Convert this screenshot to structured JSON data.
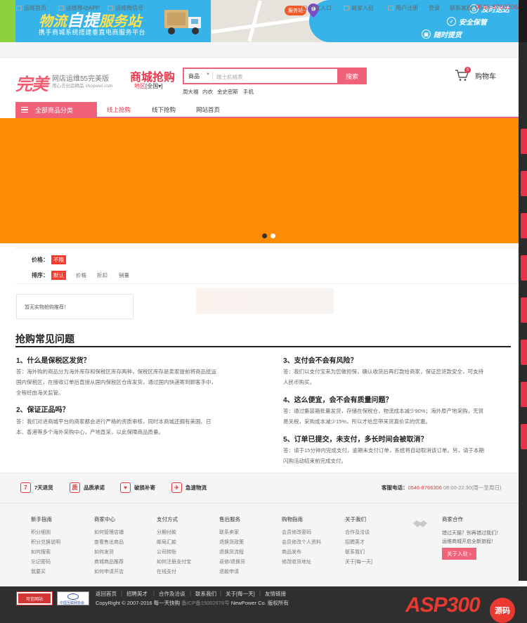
{
  "banner": {
    "title_a": "物流",
    "title_b": "自提",
    "title_c": "服务站",
    "subtitle": "携手商城系统搭建垂直电商服务平台",
    "map_tag": "服务站",
    "services": [
      "及时送达",
      "安全保管",
      "随时提货"
    ]
  },
  "topnav": {
    "left": [
      "运维首页",
      "运维移动APP",
      "运维微信号"
    ],
    "right": [
      "商家入口",
      "商家入驻",
      "用户注册",
      "登录",
      "联系客服"
    ],
    "phone": "0546-8766306"
  },
  "header": {
    "logo": "完美",
    "logo_line1": "网店运维55完美版",
    "logo_line2": "用心去创造精品 shopwwi.com",
    "shop_title": "商城抢购",
    "region_label": "地区",
    "region_value": "[全国",
    "search_category": "商品",
    "search_placeholder": "瑞士机械表",
    "search_button": "搜索",
    "hot_words": [
      "周大福",
      "内衣",
      "金史密斯",
      "手机"
    ],
    "cart_count": "0",
    "cart_label": "购物车"
  },
  "nav": {
    "all_categories": "全部商品分类",
    "items": [
      "线上抢购",
      "线下抢购",
      "网站首页"
    ]
  },
  "carousel": {
    "active_index": 0,
    "count": 2,
    "bg": "#fe8b04"
  },
  "filters": {
    "price_label": "价格：",
    "price_chip": "不限",
    "sort_label": "排序：",
    "sort_chip": "默认",
    "sort_items": [
      "价格",
      "折扣",
      "销量"
    ]
  },
  "empty_notice": "暂无实物抢购推荐！",
  "faq": {
    "title": "抢购常见问题",
    "items": [
      {
        "q": "1、什么是保税区发货？",
        "a": [
          "答：海外购的商品分为海外库存和保税区库存两种，保税区库存是卖家提前将商品抵运",
          "国内保税区，在接收订单后直接从国内保税区仓库发货，通过国内快递寄到顾客手中，",
          "全程经由海关监管。"
        ]
      },
      {
        "q": "2、保证正品吗？",
        "a": [
          "答：我们对进商城平台的商家都会进行严格的资质审核，同时本商城还拥有美国、日",
          "本、香港等多个海外采购中心，产地直采，以此保障商品质量。"
        ]
      },
      {
        "q": "3、支付会不会有风险？",
        "a": [
          "答：我们以支付宝来为您做担保，确认收货后再打款给商家，保证您货款安全，可支持",
          "人民币购买。"
        ]
      },
      {
        "q": "4、这么便宜，会不会有质量问题？",
        "a": [
          "答：通过集装箱批量发货，存储在保税仓，物流成本减少90%；海外原产地采购，无贸",
          "易关税，采购成本减少15%，所以才给您带来货真价实的优惠。"
        ]
      },
      {
        "q": "5、订单已提交，未支付，多长时间会被取消？",
        "a": [
          "答：请于15分钟内完成支付，逾期未支付订单，系统将自动取消该订单。另，请于本期",
          "闪购活动结束前完成支付。"
        ]
      }
    ]
  },
  "features": {
    "items": [
      {
        "icon": "7",
        "label": "7天退货"
      },
      {
        "icon": "质",
        "label": "品质承诺"
      },
      {
        "icon": "♥",
        "label": "破损补寄"
      },
      {
        "icon": "✈",
        "label": "急速物流"
      }
    ],
    "service_label": "客服电话：",
    "service_phone": "0546-8766306",
    "service_hours": "08:00-22:30(周一至周日)"
  },
  "footer": {
    "columns": [
      {
        "title": "新手指南",
        "links": [
          "积分细则",
          "积分兑换说明",
          "如何搜索",
          "忘记密码",
          "我要买"
        ]
      },
      {
        "title": "商家中心",
        "links": [
          "如何管理店铺",
          "查看售出商品",
          "如何发货",
          "商城商品推荐",
          "如何申请开店"
        ]
      },
      {
        "title": "支付方式",
        "links": [
          "分期付款",
          "邮局汇款",
          "公司转账",
          "如何注册支付宝",
          "在线支付"
        ]
      },
      {
        "title": "售后服务",
        "links": [
          "联系卖家",
          "退换货政策",
          "退换货流程",
          "返修/退换货",
          "退款申请"
        ]
      },
      {
        "title": "购物指南",
        "links": [
          "会员修改密码",
          "会员修改个人资料",
          "商品发布",
          "修改收货地址"
        ]
      },
      {
        "title": "关于我们",
        "links": [
          "合作及洽谈",
          "招聘英才",
          "联系我们",
          "关于[每一天]"
        ]
      }
    ],
    "merchant_title": "商家合作",
    "merchant_desc": [
      "错过天猫？别再错过我们！",
      "运维商城开启全新旅程！"
    ],
    "merchant_button": "关于入驻 ›"
  },
  "bottom": {
    "badge1": "可信网站",
    "badge2": "中国互联网协会",
    "links": [
      "返回首页",
      "招聘英才",
      "合作及洽谈",
      "联系我们",
      "关于[每一天]",
      "友情链接"
    ],
    "copyright": "CopyRight © 2007-2016 每一天快购",
    "icp": "备ICP备15002678号",
    "power": "NewPower Co. 版权所有",
    "watermark": "ASP300",
    "watermark_tag": "源码"
  }
}
